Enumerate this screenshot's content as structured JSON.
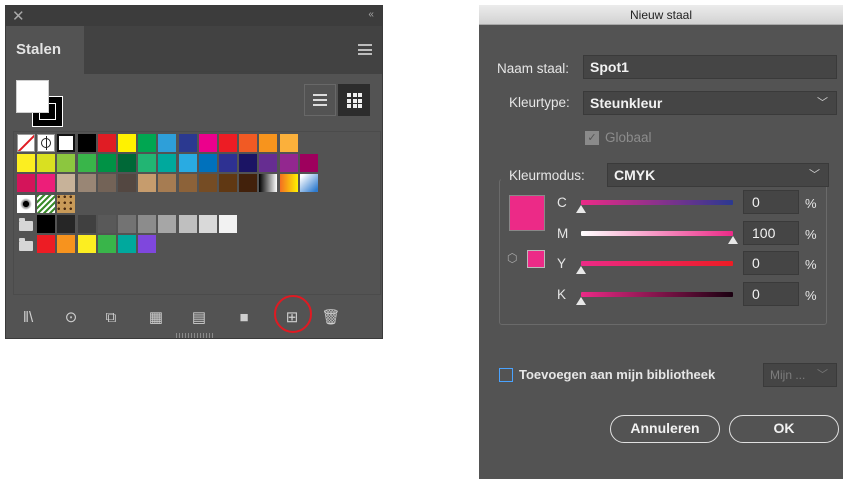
{
  "swatches_panel": {
    "tab_title": "Stalen",
    "close_glyph": "✕",
    "collapse_glyph": "‹‹",
    "rows": [
      [
        "none",
        "registration",
        "white",
        "#000000",
        "#e01c24",
        "#fff200",
        "#00a651",
        "#2e9fd9",
        "#2b3990",
        "#ec008c",
        "#ed1c24",
        "#f15a24",
        "#f7941d",
        "#fbb03b"
      ],
      [
        "#fcee21",
        "#d9e021",
        "#8cc63f",
        "#39b54a",
        "#009245",
        "#006837",
        "#22b573",
        "#00a99d",
        "#29abe2",
        "#0071bc",
        "#2e3192",
        "#1b1464",
        "#662d91",
        "#93278f",
        "#9e005d"
      ],
      [
        "#d4145a",
        "#ed1e79",
        "#c7b299",
        "#998675",
        "#736357",
        "#534741",
        "#c69c6d",
        "#a67c52",
        "#8c6239",
        "#754c24",
        "#603813",
        "#42210b",
        "grad-bw",
        "grad-yo",
        "grad-blue"
      ],
      [
        "pat-dots",
        "pat-leaf",
        "pat-leo"
      ],
      [
        "folder",
        "#000000",
        "#262626",
        "#404040",
        "#595959",
        "#737373",
        "#8c8c8c",
        "#a6a6a6",
        "#bfbfbf",
        "#d9d9d9",
        "#f2f2f2"
      ],
      [
        "folder",
        "#ed1c24",
        "#f7931e",
        "#fcee21",
        "#39b54a",
        "#00a99d",
        "#7f47dd"
      ]
    ],
    "bottom_tools": [
      {
        "name": "swatch-libraries-icon",
        "glyph": "ǁ\\"
      },
      {
        "name": "show-swatch-kinds-icon",
        "glyph": "⊙"
      },
      {
        "name": "swatch-options-icon",
        "glyph": "⧉"
      },
      {
        "name": "color-group-icon",
        "glyph": "▦"
      },
      {
        "name": "edit-color-group-icon",
        "glyph": "▤"
      },
      {
        "name": "new-color-group-folder-icon",
        "glyph": "■"
      },
      {
        "name": "new-swatch-icon",
        "glyph": "⊞"
      },
      {
        "name": "delete-swatch-icon",
        "glyph": "🗑"
      }
    ]
  },
  "dialog": {
    "title": "Nieuw staal",
    "name_label": "Naam staal:",
    "name_value": "Spot1",
    "color_type_label": "Kleurtype:",
    "color_type_value": "Steunkleur",
    "global_label": "Globaal",
    "color_mode_label": "Kleurmodus:",
    "color_mode_value": "CMYK",
    "swatch_color": "#ec2a87",
    "channels": [
      {
        "label": "C",
        "value": "0",
        "percent": 0,
        "gradient": "linear-gradient(90deg,#ec2a87,#2b3990)"
      },
      {
        "label": "M",
        "value": "100",
        "percent": 100,
        "gradient": "linear-gradient(90deg,#ffffff,#ec2a87)"
      },
      {
        "label": "Y",
        "value": "0",
        "percent": 0,
        "gradient": "linear-gradient(90deg,#ec2a87,#ed1c24)"
      },
      {
        "label": "K",
        "value": "0",
        "percent": 0,
        "gradient": "linear-gradient(90deg,#ec2a87,#1a0010)"
      }
    ],
    "percent_sign": "%",
    "add_library_label": "Toevoegen aan mijn bibliotheek",
    "library_select": "Mijn ...",
    "cancel_label": "Annuleren",
    "ok_label": "OK"
  }
}
